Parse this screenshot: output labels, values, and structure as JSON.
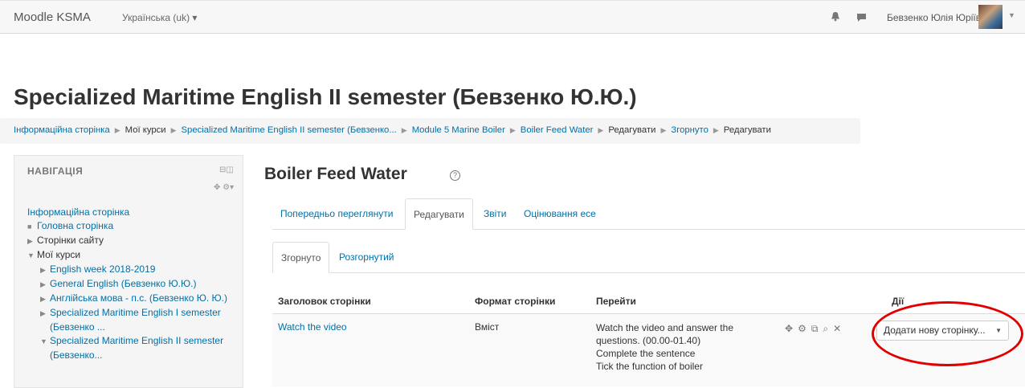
{
  "navbar": {
    "brand": "Moodle KSMA",
    "language": "Українська (uk) ▾",
    "user_name": "Бевзенко Юлія Юріївна",
    "icons": [
      "bell-icon",
      "message-icon"
    ]
  },
  "page_title": "Specialized Maritime English II semester (Бевзенко Ю.Ю.)",
  "breadcrumb": [
    {
      "label": "Інформаційна сторінка",
      "link": true
    },
    {
      "label": "Мої курси",
      "link": false
    },
    {
      "label": "Specialized Maritime English II semester (Бевзенко...",
      "link": true
    },
    {
      "label": "Module 5 Marine Boiler",
      "link": true
    },
    {
      "label": "Boiler Feed Water",
      "link": true
    },
    {
      "label": "Редагувати",
      "link": false
    },
    {
      "label": "Згорнуто",
      "link": true
    },
    {
      "label": "Редагувати",
      "link": false
    }
  ],
  "navigation": {
    "title": "НАВІГАЦІЯ",
    "home": "Інформаційна сторінка",
    "items": {
      "main_page": "Головна сторінка",
      "site_pages": "Сторінки сайту",
      "my_courses": "Мої курси",
      "courses": [
        "English week 2018-2019",
        "General English (Бевзенко Ю.Ю.)",
        "Англійська мова - п.с. (Бевзенко Ю. Ю.)",
        "Specialized Maritime English I semester",
        "(Бевзенко ...",
        "Specialized Maritime English II semester",
        "(Бевзенко..."
      ]
    }
  },
  "lesson": {
    "title": "Boiler Feed Water",
    "help_symbol": "?",
    "tabs": [
      "Попередньо переглянути",
      "Редагувати",
      "Звіти",
      "Оцінювання есе"
    ],
    "subtabs": [
      "Згорнуто",
      "Розгорнутий"
    ],
    "table": {
      "headers": [
        "Заголовок сторінки",
        "Формат сторінки",
        "Перейти",
        "Дії"
      ],
      "rows": [
        {
          "title": "Watch the video",
          "format": "Вміст",
          "go_lines": [
            "Watch the video and answer the",
            "questions. (00.00-01.40)",
            "Complete the sentence",
            "Tick the function of boiler"
          ],
          "action_icons": [
            "move-icon",
            "settings-icon",
            "copy-icon",
            "preview-icon",
            "delete-icon"
          ],
          "add_page_select": "Додати нову сторінку..."
        }
      ]
    }
  },
  "colors": {
    "link": "#0070a8",
    "highlight_circle": "#e00000"
  }
}
